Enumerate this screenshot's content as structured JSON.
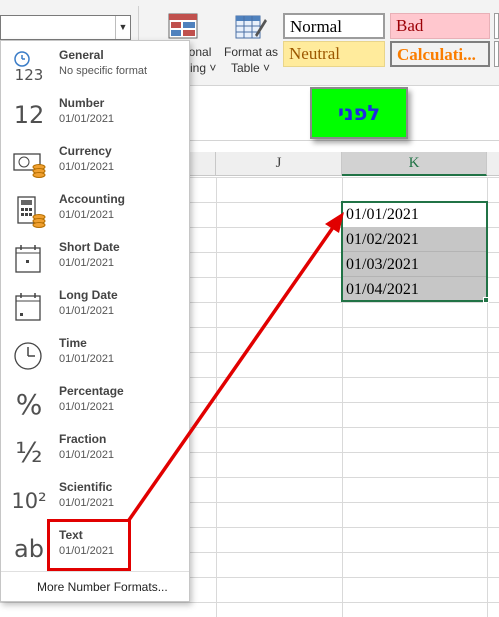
{
  "ribbon": {
    "conditional_formatting_label": [
      "ional",
      "ing ˅"
    ],
    "format_as_table_label": [
      "Format as",
      "Table ˅"
    ],
    "styles": {
      "normal": "Normal",
      "bad": "Bad",
      "neutral": "Neutral",
      "calculation": "Calculati..."
    }
  },
  "format_dropdown": {
    "items": [
      {
        "name": "General",
        "sample": "No specific format",
        "icon": "general-123-icon"
      },
      {
        "name": "Number",
        "sample": "01/01/2021",
        "icon": "number-12-icon"
      },
      {
        "name": "Currency",
        "sample": "01/01/2021",
        "icon": "currency-coins-icon"
      },
      {
        "name": "Accounting",
        "sample": "01/01/2021",
        "icon": "accounting-calculator-icon"
      },
      {
        "name": "Short Date",
        "sample": "01/01/2021",
        "icon": "short-date-calendar-icon"
      },
      {
        "name": "Long Date",
        "sample": "01/01/2021",
        "icon": "long-date-calendar-icon"
      },
      {
        "name": "Time",
        "sample": "01/01/2021",
        "icon": "clock-icon"
      },
      {
        "name": "Percentage",
        "sample": "01/01/2021",
        "icon": "percent-icon"
      },
      {
        "name": "Fraction",
        "sample": "01/01/2021",
        "icon": "fraction-icon"
      },
      {
        "name": "Scientific",
        "sample": "01/01/2021",
        "icon": "scientific-icon"
      },
      {
        "name": "Text",
        "sample": "01/01/2021",
        "icon": "text-ab-icon"
      }
    ],
    "more_formats": "More Number Formats...",
    "icon_glyphs": {
      "number": "12",
      "general": "123",
      "percent": "%",
      "fraction": "½",
      "scientific": "10²",
      "text": "ab"
    }
  },
  "sheet": {
    "columns": [
      "J",
      "K"
    ],
    "badge": "לפני",
    "cells": [
      "01/01/2021",
      "01/02/2021",
      "01/03/2021",
      "01/04/2021"
    ]
  },
  "colors": {
    "badge_bg": "#00ff00",
    "badge_text": "#1f2be0",
    "highlight": "#e10000",
    "selection": "#217346"
  }
}
